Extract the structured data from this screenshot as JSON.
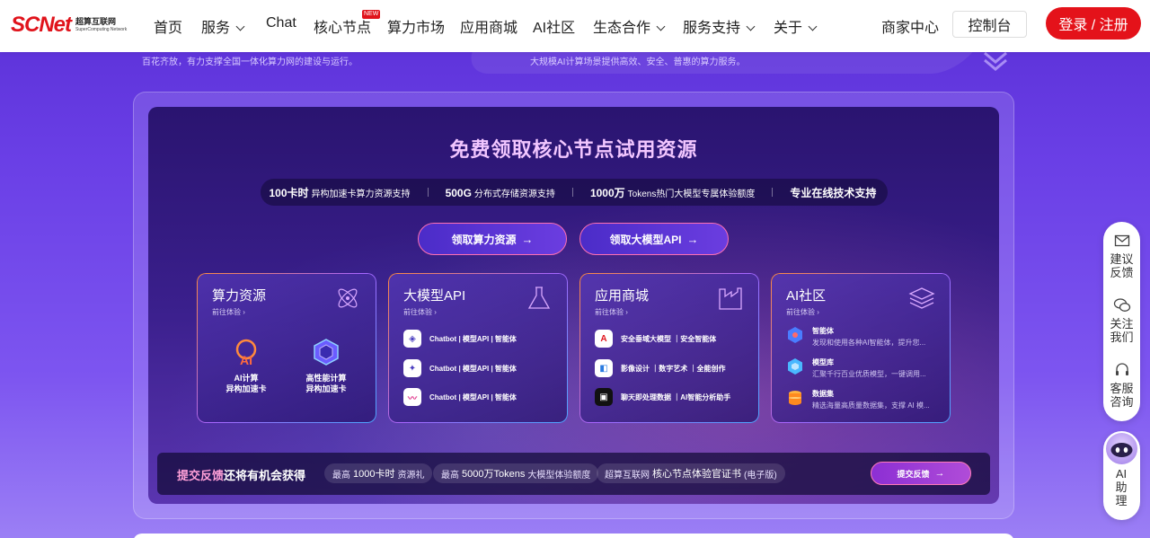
{
  "header": {
    "logo_text": "SCNet",
    "logo_cn": "超算互联网",
    "logo_en": "SuperComputing Network",
    "nav": [
      {
        "label": "首页"
      },
      {
        "label": "服务"
      },
      {
        "label": "Chat"
      },
      {
        "label": "核心节点"
      },
      {
        "label": "算力市场"
      },
      {
        "label": "应用商城"
      },
      {
        "label": "AI社区"
      },
      {
        "label": "生态合作"
      },
      {
        "label": "服务支持"
      },
      {
        "label": "关于"
      }
    ],
    "new_badge": "NEW",
    "merchant": "商家中心",
    "console": "控制台",
    "login": "登录 / 注册"
  },
  "strip": {
    "left_text": "百花齐放，有力支撑全国一体化算力网的建设与运行。",
    "right_text": "大规模AI计算场景提供高效、安全、普惠的算力服务。"
  },
  "main": {
    "title": "免费领取核心节点试用资源",
    "features": [
      {
        "big": "100卡时",
        "small": "异构加速卡算力资源支持"
      },
      {
        "big": "500G",
        "small": "分布式存储资源支持"
      },
      {
        "big": "1000万",
        "small": "Tokens热门大模型专属体验额度"
      },
      {
        "big": "专业在线技术支持",
        "small": ""
      }
    ],
    "cta_compute": "领取算力资源",
    "cta_api": "领取大模型API",
    "cards": [
      {
        "title": "算力资源",
        "sub": "前往体验 ›",
        "icon": "atom-icon",
        "items": [
          {
            "line1": "AI计算",
            "line2": "异构加速卡"
          },
          {
            "line1": "高性能计算",
            "line2": "异构加速卡"
          }
        ]
      },
      {
        "title": "大模型API",
        "sub": "前往体验 ›",
        "icon": "flask-icon",
        "rows": [
          "Chatbot | 模型API | 智能体",
          "Chatbot | 模型API | 智能体",
          "Chatbot | 模型API | 智能体"
        ]
      },
      {
        "title": "应用商城",
        "sub": "前往体验 ›",
        "icon": "factory-icon",
        "rows": [
          "安全垂域大模型 ｜安全智能体",
          "影像设计 ｜数字艺术 ｜全能创作",
          "聊天即处理数据 ｜AI智能分析助手"
        ]
      },
      {
        "title": "AI社区",
        "sub": "前往体验 ›",
        "icon": "layers-icon",
        "rows": [
          {
            "title": "智能体",
            "desc": "发现和使用各种AI智能体，提升您..."
          },
          {
            "title": "模型库",
            "desc": "汇聚千行百业优质模型，一键调用..."
          },
          {
            "title": "数据集",
            "desc": "精选海量高质量数据集，支撑 AI 模..."
          }
        ]
      }
    ],
    "feedback": {
      "title_highlight": "提交反馈",
      "title_rest": "还将有机会获得",
      "chips": [
        {
          "pre": "最高",
          "big": "1000卡时",
          "post": "资源礼"
        },
        {
          "pre": "最高",
          "big": "5000万Tokens",
          "post": "大模型体验额度"
        },
        {
          "pre": "超算互联网",
          "big": "核心节点体验官证书",
          "post": "(电子版)"
        }
      ],
      "button": "提交反馈"
    }
  },
  "side": {
    "suggest": "建议反馈",
    "follow": "关注我们",
    "support": "客服咨询",
    "ai": "AI助理"
  },
  "colors": {
    "brand_red": "#e4121a",
    "bg_purple": "#6a3fe6",
    "title_pink": "#f2c6ff"
  }
}
